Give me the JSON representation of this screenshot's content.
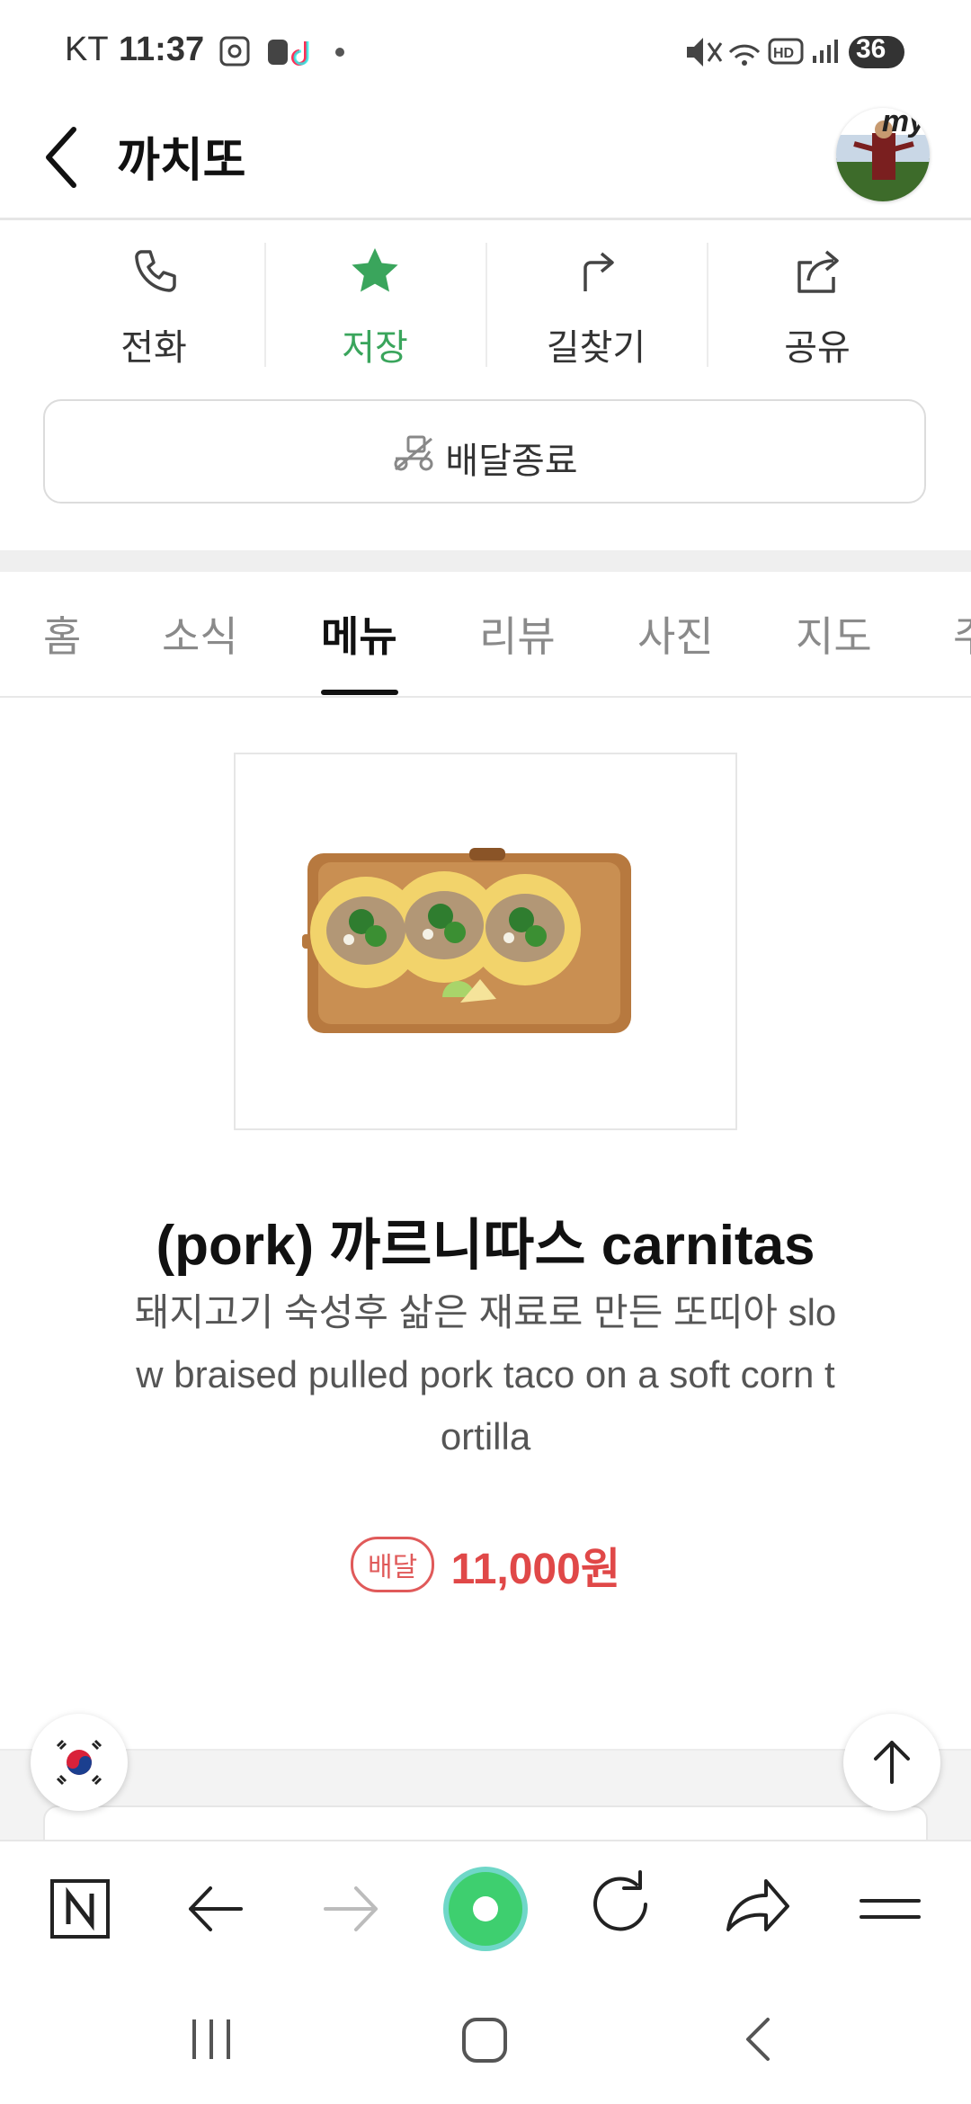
{
  "status_bar": {
    "carrier": "KT",
    "time": "11:37",
    "battery": "36"
  },
  "header": {
    "back_icon": "back-arrow-icon",
    "title": "까치또",
    "avatar_text": "my"
  },
  "actions": [
    {
      "label": "전화",
      "icon": "phone-icon"
    },
    {
      "label": "저장",
      "icon": "star-icon",
      "active": true
    },
    {
      "label": "길찾기",
      "icon": "directions-icon"
    },
    {
      "label": "공유",
      "icon": "share-icon"
    }
  ],
  "delivery_button": {
    "label": "배달종료",
    "icon": "delivery-scooter-icon"
  },
  "tabs": [
    "홈",
    "소식",
    "메뉴",
    "리뷰",
    "사진",
    "지도",
    "주"
  ],
  "active_tab": "메뉴",
  "menu_item": {
    "name": "(pork) 까르니따스 carnitas",
    "description": "돼지고기 숙성후 삶은 재료로 만든 또띠아 slow braised pulled pork taco on a soft corn tortilla",
    "badge": "배달",
    "price": "11,000원"
  },
  "toolbar": {
    "icons": [
      "naver-n-icon",
      "back-icon",
      "forward-icon",
      "green-dot-icon",
      "refresh-icon",
      "share-icon",
      "menu-icon"
    ]
  },
  "colors": {
    "accent_green": "#3aa55c",
    "price_red": "#e04848",
    "text_dark": "#111111",
    "text_gray": "#8a8a8a"
  }
}
